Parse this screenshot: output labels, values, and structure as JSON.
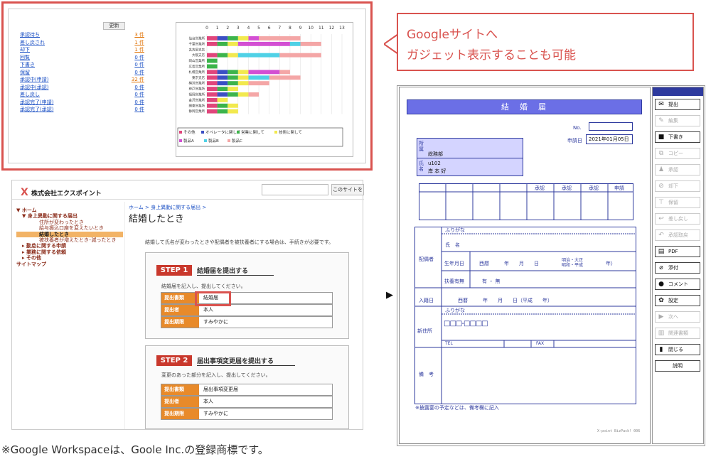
{
  "gadget": {
    "update_button": "更新",
    "rows": [
      {
        "label": "承認待ち",
        "value": "3 件",
        "hot": true
      },
      {
        "label": "差し戻され",
        "value": "1 件",
        "hot": true
      },
      {
        "label": "却下",
        "value": "1 件",
        "hot": true
      },
      {
        "label": "回覧",
        "value": "0 件",
        "hot": false
      },
      {
        "label": "下書き",
        "value": "0 件",
        "hot": false
      },
      {
        "label": "保留",
        "value": "0 件",
        "hot": false
      },
      {
        "label": "承認中(申請)",
        "value": "32 件",
        "hot": true
      },
      {
        "label": "承認中(承認)",
        "value": "0 件",
        "hot": false
      },
      {
        "label": "差し戻し",
        "value": "0 件",
        "hot": false
      },
      {
        "label": "承認完了(申請)",
        "value": "0 件",
        "hot": false
      },
      {
        "label": "承認完了(承認)",
        "value": "0 件",
        "hot": false
      }
    ]
  },
  "chart_data": {
    "type": "bar",
    "orientation": "horizontal-stacked",
    "xlim": [
      0,
      13
    ],
    "x_ticks": [
      "0",
      "1",
      "2",
      "3",
      "4",
      "5",
      "6",
      "7",
      "8",
      "9",
      "10",
      "11",
      "12",
      "13"
    ],
    "categories": [
      "仙台営業所",
      "千葉営業所",
      "名古屋支店",
      "大阪支店",
      "岡山営業所",
      "広島営業所",
      "札幌営業所",
      "東京支店",
      "横浜営業所",
      "神戸営業所",
      "福岡営業所",
      "金沢営業所",
      "関東営業所",
      "静岡営業所"
    ],
    "series": [
      {
        "name": "その他",
        "color": "#e0457b",
        "values": [
          1,
          1,
          0,
          1,
          0,
          0,
          1,
          1,
          1,
          1,
          1,
          1,
          1,
          1
        ]
      },
      {
        "name": "オペレータに関して",
        "color": "#3b4fc4",
        "values": [
          1,
          0,
          0,
          0,
          0,
          0,
          1,
          1,
          1,
          0,
          1,
          0,
          0,
          0
        ]
      },
      {
        "name": "営業に関して",
        "color": "#3cb44b",
        "values": [
          1,
          1,
          0,
          1,
          1,
          1,
          1,
          1,
          1,
          1,
          1,
          0,
          1,
          1
        ]
      },
      {
        "name": "技術に関して",
        "color": "#f2e94e",
        "values": [
          1,
          1,
          0,
          1,
          0,
          0,
          1,
          1,
          1,
          1,
          1,
          1,
          1,
          1
        ]
      },
      {
        "name": "製品A",
        "color": "#d34fd3",
        "values": [
          1,
          5,
          0,
          0,
          0,
          0,
          3,
          0,
          0,
          0,
          0,
          0,
          0,
          0
        ]
      },
      {
        "name": "製品B",
        "color": "#4fd1e6",
        "values": [
          0,
          1,
          0,
          4,
          0,
          0,
          0,
          2,
          0,
          0,
          0,
          0,
          0,
          0
        ]
      },
      {
        "name": "製品C",
        "color": "#f4a6a6",
        "values": [
          4,
          2,
          0,
          4,
          0,
          0,
          1,
          3,
          2,
          0,
          1,
          0,
          0,
          0
        ]
      }
    ]
  },
  "callout": {
    "line1": "Googleサイトへ",
    "line2": "ガジェット表示することも可能"
  },
  "portal": {
    "company": "株式会社エクスポイント",
    "search_button": "このサイトを",
    "breadcrumb": "ホーム > 身上異動に関する届出 >",
    "title": "結婚したとき",
    "intro": "結婚して氏名が変わったときや配偶者を被扶養者にする場合は、手続きが必要です。",
    "nav": [
      {
        "label": "▼ ホーム",
        "indent": 0,
        "active": false
      },
      {
        "label": "▼ 身上異動に関する届出",
        "indent": 1,
        "active": false
      },
      {
        "label": "住所が変わったとき",
        "indent": 2,
        "active": false
      },
      {
        "label": "給与振込口座を変えたいとき",
        "indent": 2,
        "active": false
      },
      {
        "label": "結婚したとき",
        "indent": 2,
        "active": true
      },
      {
        "label": "被扶養者が増えたとき･減ったとき",
        "indent": 2,
        "active": false
      },
      {
        "label": "▸ 勤怠に関する申請",
        "indent": 1,
        "active": false
      },
      {
        "label": "▸ 業務に関する依頼",
        "indent": 1,
        "active": false
      },
      {
        "label": "▸ その他",
        "indent": 1,
        "active": false
      },
      {
        "label": "サイトマップ",
        "indent": 0,
        "active": false
      }
    ],
    "step1": {
      "badge": "STEP 1",
      "title": "結婚届を提出する",
      "desc": "結婚届を記入し、提出してください。",
      "rows": [
        [
          "提出書類",
          "結婚届"
        ],
        [
          "提出者",
          "本人"
        ],
        [
          "提出期限",
          "すみやかに"
        ]
      ]
    },
    "step2": {
      "badge": "STEP 2",
      "title": "届出事項変更届を提出する",
      "desc": "変更のあった部分を記入し、提出してください。",
      "rows": [
        [
          "提出書類",
          "届出事項変更届"
        ],
        [
          "提出者",
          "本人"
        ],
        [
          "提出期限",
          "すみやかに"
        ]
      ]
    }
  },
  "form": {
    "title": "結　婚　届",
    "no_label": "No.",
    "date_label": "申請日",
    "date_value": "2021年01月05日",
    "dept_label": "所属",
    "dept_value": "総務部",
    "name_label": "氏名",
    "name_id": "u102",
    "name_value": "岸 本 好",
    "approvals": [
      "承認",
      "承認",
      "承認",
      "申請"
    ],
    "spouse": "配偶者",
    "furigana": "ふりがな",
    "shimei": "氏　名",
    "birth_label": "生年月日",
    "birth_value": "西暦　　　年　　月　　日",
    "era_top": "明治・大正",
    "era_bottom": "昭和・平成",
    "era_year": "年）",
    "dependent_label": "扶養有無",
    "dependent_value": "有 ・ 無",
    "entry_label": "入籍日",
    "entry_value": "西暦　　　年　　月　　日（平成　　年）",
    "new_address": "新住所",
    "postal": "□□□-□□□□",
    "tel": "TEL",
    "fax": "FAX",
    "remarks": "備　考",
    "footnote": "※披露宴の予定などは、備考欄に記入",
    "footer": "X-point BizPack! 006"
  },
  "toolbar": [
    {
      "label": "提出",
      "icon": "✉",
      "name": "submit-button",
      "disabled": false
    },
    {
      "label": "編集",
      "icon": "✎",
      "name": "edit-button",
      "disabled": true
    },
    {
      "label": "下書き",
      "icon": "■",
      "name": "draft-button",
      "disabled": false
    },
    {
      "label": "コピー",
      "icon": "⧉",
      "name": "copy-button",
      "disabled": true
    },
    {
      "label": "承認",
      "icon": "♟",
      "name": "approve-button",
      "disabled": true
    },
    {
      "label": "却下",
      "icon": "⊘",
      "name": "reject-button",
      "disabled": true
    },
    {
      "label": "保留",
      "icon": "⊤",
      "name": "hold-button",
      "disabled": true
    },
    {
      "label": "差し戻し",
      "icon": "↩",
      "name": "send-back-button",
      "disabled": true
    },
    {
      "label": "承認取戻",
      "icon": "↶",
      "name": "withdraw-button",
      "disabled": true
    },
    {
      "label": "PDF",
      "icon": "▤",
      "name": "pdf-button",
      "disabled": false
    },
    {
      "label": "添付",
      "icon": "⌀",
      "name": "attach-button",
      "disabled": false
    },
    {
      "label": "コメント",
      "icon": "●",
      "name": "comment-button",
      "disabled": false
    },
    {
      "label": "設定",
      "icon": "✿",
      "name": "settings-button",
      "disabled": false
    },
    {
      "label": "次へ",
      "icon": "▶",
      "name": "next-button",
      "disabled": true
    },
    {
      "label": "関連書類",
      "icon": "▥",
      "name": "related-docs-button",
      "disabled": true
    },
    {
      "label": "閉じる",
      "icon": "▮",
      "name": "close-button",
      "disabled": false
    },
    {
      "label": "説明",
      "icon": "",
      "name": "help-button",
      "disabled": false
    }
  ],
  "footnote": "※Google Workspaceは、Goole Inc.の登録商標です。"
}
